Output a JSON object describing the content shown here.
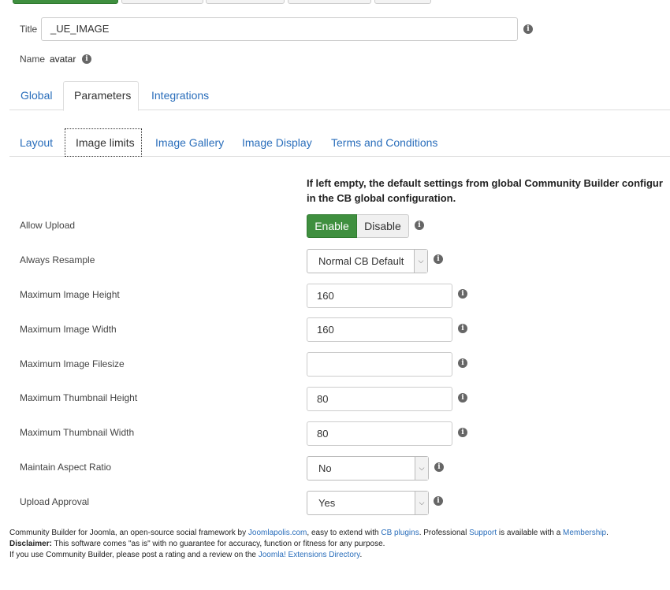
{
  "form": {
    "title_label": "Title",
    "title_value": "_UE_IMAGE",
    "name_label": "Name",
    "name_value": "avatar"
  },
  "tabs": [
    "Global",
    "Parameters",
    "Integrations"
  ],
  "subtabs": [
    "Layout",
    "Image limits",
    "Image Gallery",
    "Image Display",
    "Terms and Conditions"
  ],
  "notice": {
    "line1": "If left empty, the default settings from global Community Builder configur",
    "line2": "in the CB global configuration."
  },
  "fields": {
    "allow_upload": {
      "label": "Allow Upload",
      "enable": "Enable",
      "disable": "Disable",
      "selected": "Enable"
    },
    "always_resample": {
      "label": "Always Resample",
      "value": "Normal CB Default"
    },
    "max_image_height": {
      "label": "Maximum Image Height",
      "value": "160"
    },
    "max_image_width": {
      "label": "Maximum Image Width",
      "value": "160"
    },
    "max_image_filesize": {
      "label": "Maximum Image Filesize",
      "value": ""
    },
    "max_thumb_height": {
      "label": "Maximum Thumbnail Height",
      "value": "80"
    },
    "max_thumb_width": {
      "label": "Maximum Thumbnail Width",
      "value": "80"
    },
    "maintain_aspect": {
      "label": "Maintain Aspect Ratio",
      "value": "No"
    },
    "upload_approval": {
      "label": "Upload Approval",
      "value": "Yes"
    }
  },
  "footer": {
    "l1_a": "Community Builder for Joomla, an open-source social framework by ",
    "l1_link1": "Joomlapolis.com",
    "l1_b": ", easy to extend with ",
    "l1_link2": "CB plugins",
    "l1_c": ". Professional ",
    "l1_link3": "Support",
    "l1_d": " is available with a ",
    "l1_link4": "Membership",
    "l1_e": ".",
    "l2_bold": "Disclaimer:",
    "l2_text": " This software comes \"as is\" with no guarantee for accuracy, function or fitness for any purpose.",
    "l3_a": "If you use Community Builder, please post a rating and a review on the ",
    "l3_link": "Joomla! Extensions Directory",
    "l3_b": "."
  },
  "colors": {
    "accent_green": "#3f8f3f",
    "link_blue": "#2a6ebb",
    "info_icon": "#666666"
  }
}
